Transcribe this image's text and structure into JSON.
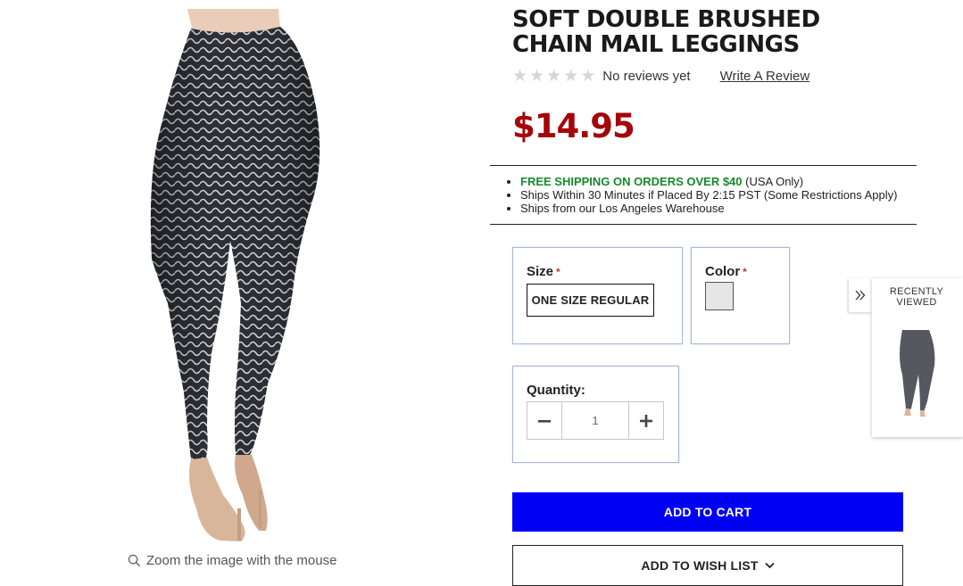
{
  "product": {
    "title": "SOFT DOUBLE BRUSHED CHAIN MAIL LEGGINGS",
    "price": "$14.95",
    "rating": {
      "stars_filled": 0,
      "stars_total": 5,
      "reviews_text": "No reviews yet",
      "write_review_label": "Write A Review"
    },
    "image_alt": "chain-mail-leggings-photo",
    "zoom_hint": "Zoom the image with the mouse"
  },
  "shipping": {
    "free_label": "FREE SHIPPING ON ORDERS OVER $40",
    "free_suffix": " (USA Only)",
    "line2": "Ships Within 30 Minutes if Placed By 2:15 PST (Some Restrictions Apply)",
    "line3": "Ships from our Los Angeles Warehouse"
  },
  "options": {
    "size": {
      "label": "Size",
      "required_mark": "*",
      "selected": "ONE SIZE REGULAR"
    },
    "color": {
      "label": "Color",
      "required_mark": "*",
      "swatch_color": "#e6e6e6"
    },
    "quantity": {
      "label": "Quantity:",
      "value": "1",
      "decrement_icon": "minus-icon",
      "increment_icon": "plus-icon"
    }
  },
  "actions": {
    "add_to_cart": "ADD TO CART",
    "add_to_wishlist": "ADD TO WISH LIST"
  },
  "recently_viewed": {
    "title": "RECENTLY VIEWED",
    "toggle_icon": "double-chevron-right-icon"
  },
  "colors": {
    "price": "#a4060a",
    "free_shipping": "#17882c",
    "primary_button": "#0000f5",
    "required": "#c0392b"
  }
}
